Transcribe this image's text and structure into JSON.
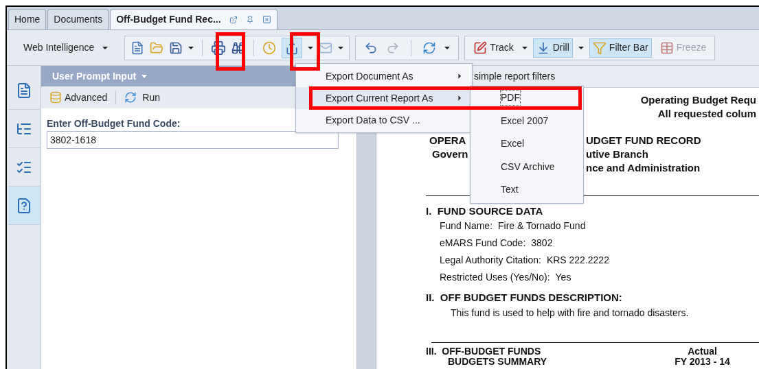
{
  "tabs": [
    {
      "label": "Home",
      "selected": false
    },
    {
      "label": "Documents",
      "selected": false
    },
    {
      "label": "Off-Budget Fund Rec...",
      "selected": true
    }
  ],
  "toolbar": {
    "app_menu": "Web Intelligence",
    "track": "Track",
    "drill": {
      "label": "Drill",
      "on": true
    },
    "filter_bar": {
      "label": "Filter Bar",
      "on": true
    },
    "freeze": {
      "label": "Freeze",
      "disabled": true
    },
    "export_pressed": true
  },
  "side_tabs": [
    {
      "kind": "document",
      "selected": false
    },
    {
      "kind": "tree",
      "selected": false
    },
    {
      "kind": "checklist",
      "selected": false
    },
    {
      "kind": "prompt",
      "selected": true
    }
  ],
  "side_panel": {
    "title": "User Prompt Input",
    "advanced": "Advanced",
    "run": "Run",
    "prompt_label": "Enter Off-Budget Fund Code:",
    "prompt_value": "3802-1618"
  },
  "export_menu": {
    "items": [
      {
        "label": "Export Document As",
        "submenu": true,
        "highlighted": false
      },
      {
        "label": "Export Current Report As",
        "submenu": true,
        "highlighted": true
      },
      {
        "label": "Export Data to CSV ...",
        "submenu": false,
        "highlighted": false
      }
    ],
    "submenu": [
      {
        "label": "PDF",
        "selected": true
      },
      {
        "label": "Excel 2007",
        "selected": false
      },
      {
        "label": "Excel",
        "selected": false
      },
      {
        "label": "CSV Archive",
        "selected": false
      },
      {
        "label": "Text",
        "selected": false
      }
    ]
  },
  "annotations": [
    {
      "kind": "print"
    },
    {
      "kind": "export"
    },
    {
      "kind": "current-report"
    }
  ],
  "report": {
    "filter_hint": "simple report filters",
    "header_right": [
      "Operating Budget Requ",
      "All requested colum"
    ],
    "title_left": "OPERA",
    "title_right": "UDGET FUND RECORD",
    "line2_left": "Govern",
    "line2_right": "utive Branch",
    "line3_right": "nce and Administration",
    "section1": {
      "heading": "I.  FUND SOURCE DATA",
      "fields": [
        {
          "label": "Fund Name:",
          "value": "Fire & Tornado Fund"
        },
        {
          "label": "eMARS Fund Code:",
          "value": "3802"
        },
        {
          "label": "Legal Authority Citation:",
          "value": "KRS 222.2222"
        },
        {
          "label": "Restricted Uses (Yes/No):",
          "value": "Yes"
        }
      ]
    },
    "section2": {
      "heading": "II.  OFF BUDGET FUNDS DESCRIPTION:",
      "text": "This fund is used to help with fire and tornado disasters."
    },
    "section3": {
      "heading": "III.  OFF-BUDGET FUNDS",
      "subheading": "BUDGETS SUMMARY",
      "column_title": "Actual",
      "column_sub": "FY 2013 - 14"
    }
  }
}
